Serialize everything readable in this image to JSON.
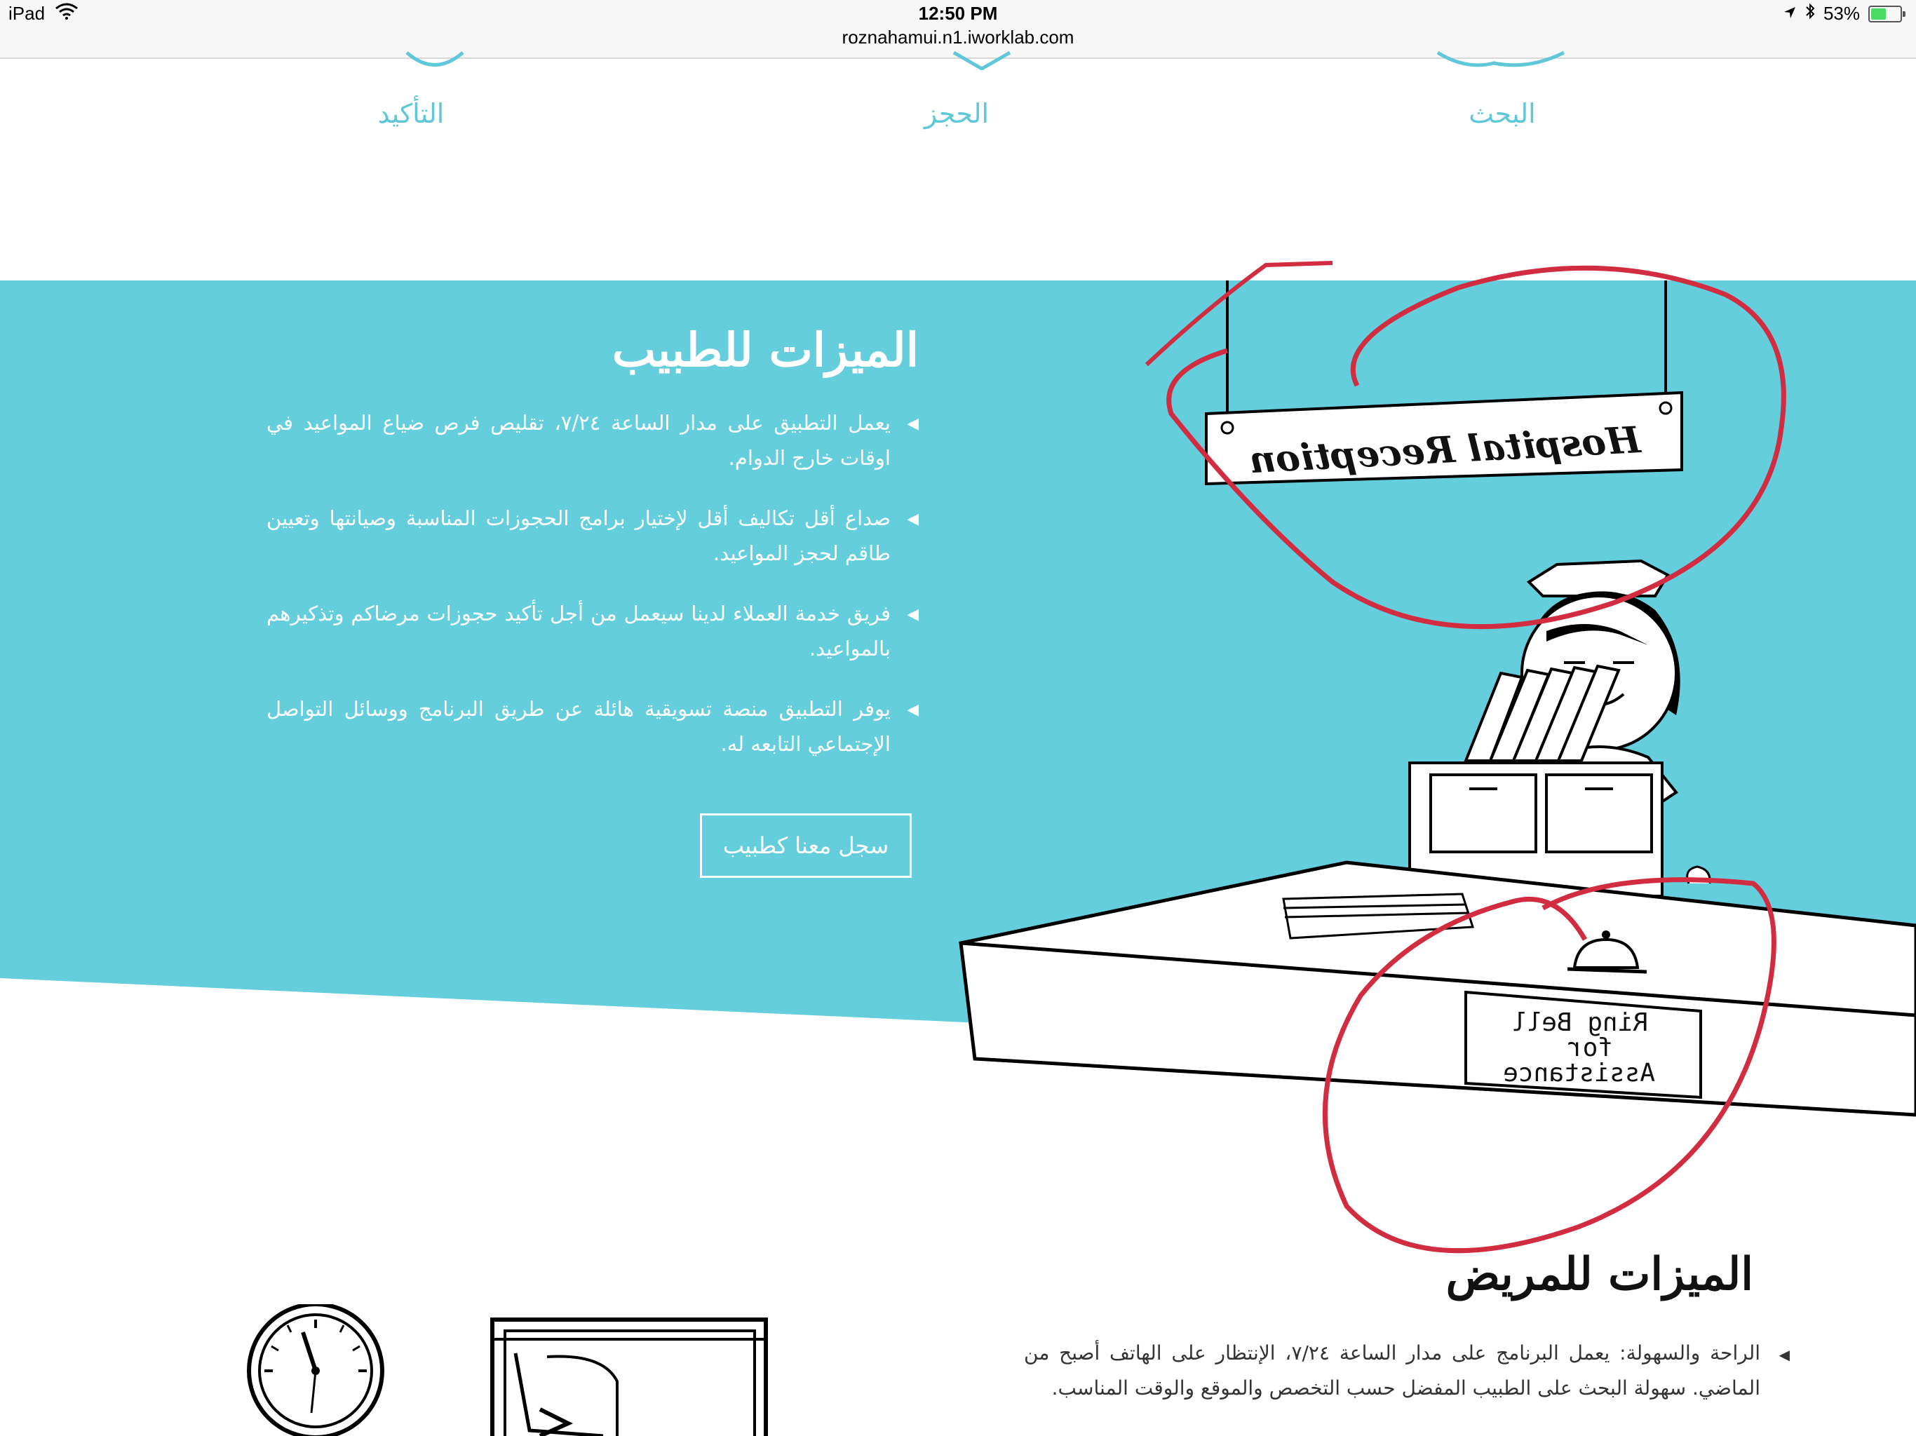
{
  "status_bar": {
    "device": "iPad",
    "time": "12:50 PM",
    "url": "roznahamui.n1.iworklab.com",
    "battery": "53%",
    "battery_level": 0.53
  },
  "steps": [
    {
      "label": "البحث"
    },
    {
      "label": "الحجز"
    },
    {
      "label": "التأكيد"
    }
  ],
  "doctor_section": {
    "title": "الميزات للطبيب",
    "features": [
      "يعمل التطبيق على مدار الساعة ٧/٢٤، تقليص فرص ضياع المواعيد في اوقات خارج الدوام.",
      "صداع أقل تكاليف أقل لإختيار برامج الحجوزات المناسبة وصيانتها وتعيين طاقم لحجز المواعيد.",
      "فريق خدمة العملاء لدينا سيعمل من أجل تأكيد حجوزات مرضاكم وتذكيرهم بالمواعيد.",
      "يوفر التطبيق منصة تسويقية هائلة عن طريق البرنامج ووسائل التواصل الإجتماعي التابعه له."
    ],
    "button_label": "سجل معنا كطبيب"
  },
  "illustration": {
    "sign_text": "Hospital Reception",
    "bell_sign_line1": "Ring Bell",
    "bell_sign_line2": "for",
    "bell_sign_line3": "Assistance"
  },
  "patient_section": {
    "title": "الميزات للمريض",
    "features": [
      "الراحة والسهولة: يعمل البرنامج على مدار الساعة ٧/٢٤، الإنتظار على الهاتف أصبح من الماضي. سهولة البحث على الطبيب المفضل حسب التخصص والموقع والوقت المناسب."
    ]
  },
  "colors": {
    "teal": "#64cedd",
    "accent_text": "#5fc8d8",
    "annotation_red": "#d12c3f"
  },
  "icons": [
    "wifi-icon",
    "location-icon",
    "bluetooth-icon",
    "battery-icon",
    "bullet-arrow-icon",
    "clock-icon"
  ]
}
